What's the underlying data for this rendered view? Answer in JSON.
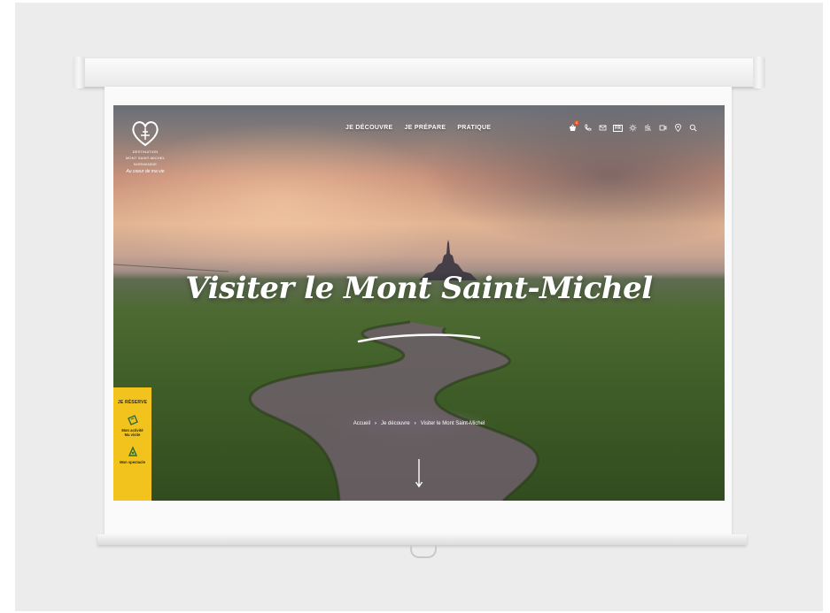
{
  "site": {
    "logo": {
      "icon": "heart-logo-icon",
      "line1": "DESTINATION",
      "line2": "MONT SAINT-MICHEL",
      "line3": "NORMANDIE",
      "signature": "Au coeur de ma vie"
    },
    "nav": [
      {
        "label": "JE DÉCOUVRE"
      },
      {
        "label": "JE PRÉPARE"
      },
      {
        "label": "PRATIQUE"
      }
    ],
    "icons": [
      {
        "name": "basket-icon",
        "badge": "1"
      },
      {
        "name": "phone-icon"
      },
      {
        "name": "mail-icon"
      },
      {
        "name": "language-fr-icon",
        "text": "FR"
      },
      {
        "name": "weather-sun-icon"
      },
      {
        "name": "tide-icon"
      },
      {
        "name": "webcam-icon"
      },
      {
        "name": "map-pin-icon"
      },
      {
        "name": "search-icon"
      }
    ],
    "hero": {
      "title": "Visiter le Mont Saint-Michel"
    },
    "breadcrumb": {
      "items": [
        "Accueil",
        "Je découvre",
        "Visiter le Mont Saint-Michel"
      ]
    },
    "reserve": {
      "heading": "JE RÉSERVE",
      "items": [
        {
          "label1": "Mon activité",
          "label2": "Ma visite",
          "icon": "ticket-icon"
        },
        {
          "label1": "Mon spectacle",
          "label2": "",
          "icon": "show-icon"
        }
      ]
    },
    "colors": {
      "accent": "#f2c31c",
      "badge": "#e8532b"
    }
  }
}
